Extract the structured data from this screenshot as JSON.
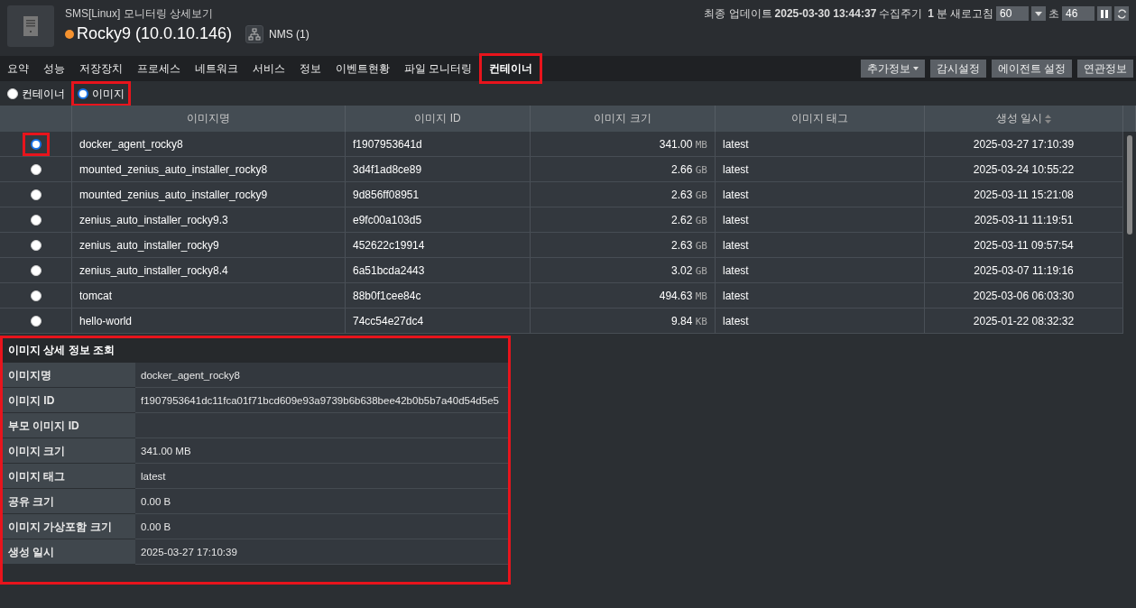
{
  "header": {
    "subtitle": "SMS[Linux] 모니터링 상세보기",
    "host": "Rocky9 (10.0.10.146)",
    "status_dot": {
      "color": "#f5922f"
    },
    "nms": "NMS (1)",
    "update_label": "최종 업데이트",
    "update_time": "2025-03-30 13:44:37",
    "cycle_label": "수집주기",
    "cycle_value": "1",
    "cycle_unit": "분",
    "refresh_label": "새로고침",
    "refresh_value": "60",
    "seconds_label": "초",
    "seconds_value": "46"
  },
  "tabs": [
    {
      "label": "요약",
      "selected": false,
      "highlighted": false
    },
    {
      "label": "성능",
      "selected": false,
      "highlighted": false
    },
    {
      "label": "저장장치",
      "selected": false,
      "highlighted": false
    },
    {
      "label": "프로세스",
      "selected": false,
      "highlighted": false
    },
    {
      "label": "네트워크",
      "selected": false,
      "highlighted": false
    },
    {
      "label": "서비스",
      "selected": false,
      "highlighted": false
    },
    {
      "label": "정보",
      "selected": false,
      "highlighted": false
    },
    {
      "label": "이벤트현황",
      "selected": false,
      "highlighted": false
    },
    {
      "label": "파일 모니터링",
      "selected": false,
      "highlighted": false
    },
    {
      "label": "컨테이너",
      "selected": true,
      "highlighted": true
    }
  ],
  "tab_buttons": [
    {
      "label": "추가정보",
      "dropdown": true
    },
    {
      "label": "감시설정",
      "dropdown": false
    },
    {
      "label": "에이전트 설정",
      "dropdown": false
    },
    {
      "label": "연관정보",
      "dropdown": false
    }
  ],
  "view_options": [
    {
      "label": "컨테이너",
      "selected": false,
      "highlighted": false
    },
    {
      "label": "이미지",
      "selected": true,
      "highlighted": true
    }
  ],
  "table": {
    "columns": [
      {
        "label": "이미지명",
        "sorted": false
      },
      {
        "label": "이미지 ID",
        "sorted": false
      },
      {
        "label": "이미지 크기",
        "sorted": false
      },
      {
        "label": "이미지 태그",
        "sorted": false
      },
      {
        "label": "생성 일시",
        "sorted": true
      }
    ],
    "rows": [
      {
        "selected": true,
        "highlighted": true,
        "name": "docker_agent_rocky8",
        "id": "f1907953641d",
        "size": "341.00",
        "unit": "MB",
        "tag": "latest",
        "created": "2025-03-27 17:10:39"
      },
      {
        "selected": false,
        "highlighted": false,
        "name": "mounted_zenius_auto_installer_rocky8",
        "id": "3d4f1ad8ce89",
        "size": "2.66",
        "unit": "GB",
        "tag": "latest",
        "created": "2025-03-24 10:55:22"
      },
      {
        "selected": false,
        "highlighted": false,
        "name": "mounted_zenius_auto_installer_rocky9",
        "id": "9d856ff08951",
        "size": "2.63",
        "unit": "GB",
        "tag": "latest",
        "created": "2025-03-11 15:21:08"
      },
      {
        "selected": false,
        "highlighted": false,
        "name": "zenius_auto_installer_rocky9.3",
        "id": "e9fc00a103d5",
        "size": "2.62",
        "unit": "GB",
        "tag": "latest",
        "created": "2025-03-11 11:19:51"
      },
      {
        "selected": false,
        "highlighted": false,
        "name": "zenius_auto_installer_rocky9",
        "id": "452622c19914",
        "size": "2.63",
        "unit": "GB",
        "tag": "latest",
        "created": "2025-03-11 09:57:54"
      },
      {
        "selected": false,
        "highlighted": false,
        "name": "zenius_auto_installer_rocky8.4",
        "id": "6a51bcda2443",
        "size": "3.02",
        "unit": "GB",
        "tag": "latest",
        "created": "2025-03-07 11:19:16"
      },
      {
        "selected": false,
        "highlighted": false,
        "name": "tomcat",
        "id": "88b0f1cee84c",
        "size": "494.63",
        "unit": "MB",
        "tag": "latest",
        "created": "2025-03-06 06:03:30"
      },
      {
        "selected": false,
        "highlighted": false,
        "name": "hello-world",
        "id": "74cc54e27dc4",
        "size": "9.84",
        "unit": "KB",
        "tag": "latest",
        "created": "2025-01-22 08:32:32"
      }
    ]
  },
  "detail": {
    "title": "이미지 상세 정보 조회",
    "highlighted": true,
    "fields": [
      {
        "label": "이미지명",
        "value": "docker_agent_rocky8"
      },
      {
        "label": "이미지 ID",
        "value": "f1907953641dc11fca01f71bcd609e93a9739b6b638bee42b0b5b7a40d54d5e5"
      },
      {
        "label": "부모 이미지 ID"
      },
      {
        "label": "이미지 크기",
        "value": "341.00 MB"
      },
      {
        "label": "이미지 태그",
        "value": "latest"
      },
      {
        "label": "공유 크기",
        "value": "0.00 B"
      },
      {
        "label": "이미지 가상포함 크기",
        "value": "0.00 B"
      },
      {
        "label": "생성 일시",
        "value": "2025-03-27 17:10:39"
      }
    ]
  }
}
